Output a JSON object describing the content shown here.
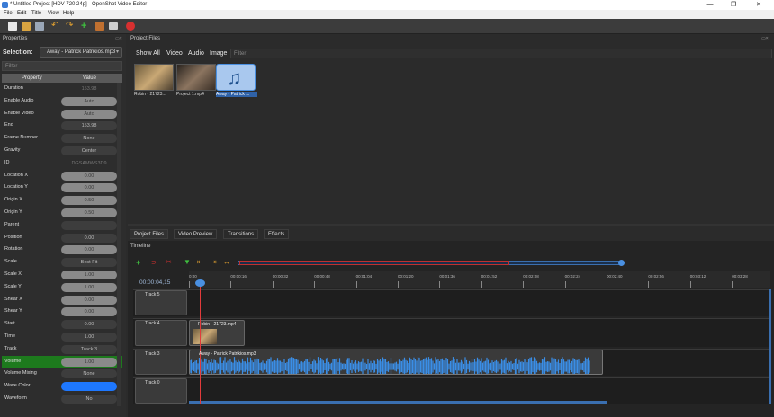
{
  "window": {
    "title": "* Untitled Project [HDV 720 24p] - OpenShot Video Editor",
    "controls": [
      "—",
      "❐",
      "✕"
    ]
  },
  "menubar": [
    "File",
    "Edit",
    "Title",
    "View",
    "Help"
  ],
  "properties": {
    "dock_title": "Properties",
    "selection_label": "Selection:",
    "selection_value": "Away - Patrick Patrikios.mp3",
    "filter_placeholder": "Filter",
    "col_property": "Property",
    "col_value": "Value",
    "rows": [
      {
        "name": "Duration",
        "value": "153.98",
        "style": "dim"
      },
      {
        "name": "Enable Audio",
        "value": "Auto",
        "style": "slider"
      },
      {
        "name": "Enable Video",
        "value": "Auto",
        "style": "slider"
      },
      {
        "name": "End",
        "value": "153.98",
        "style": "plain"
      },
      {
        "name": "Frame Number",
        "value": "None",
        "style": "plain"
      },
      {
        "name": "Gravity",
        "value": "Center",
        "style": "plain"
      },
      {
        "name": "ID",
        "value": "DGSAMWS3D9",
        "style": "dim"
      },
      {
        "name": "Location X",
        "value": "0.00",
        "style": "slider"
      },
      {
        "name": "Location Y",
        "value": "0.00",
        "style": "slider"
      },
      {
        "name": "Origin X",
        "value": "0.50",
        "style": "slider"
      },
      {
        "name": "Origin Y",
        "value": "0.50",
        "style": "slider"
      },
      {
        "name": "Parent",
        "value": "",
        "style": "plain"
      },
      {
        "name": "Position",
        "value": "0.00",
        "style": "plain"
      },
      {
        "name": "Rotation",
        "value": "0.00",
        "style": "slider"
      },
      {
        "name": "Scale",
        "value": "Best Fit",
        "style": "plain"
      },
      {
        "name": "Scale X",
        "value": "1.00",
        "style": "slider"
      },
      {
        "name": "Scale Y",
        "value": "1.00",
        "style": "slider"
      },
      {
        "name": "Shear X",
        "value": "0.00",
        "style": "slider"
      },
      {
        "name": "Shear Y",
        "value": "0.00",
        "style": "slider"
      },
      {
        "name": "Start",
        "value": "0.00",
        "style": "plain"
      },
      {
        "name": "Time",
        "value": "1.00",
        "style": "plain"
      },
      {
        "name": "Track",
        "value": "Track 3",
        "style": "plain"
      },
      {
        "name": "Volume",
        "value": "1.00",
        "style": "volume"
      },
      {
        "name": "Volume Mixing",
        "value": "None",
        "style": "plain"
      },
      {
        "name": "Wave Color",
        "value": "",
        "style": "color"
      },
      {
        "name": "Waveform",
        "value": "No",
        "style": "plain"
      }
    ]
  },
  "project_files": {
    "dock_title": "Project Files",
    "tabs": [
      "Show All",
      "Video",
      "Audio",
      "Image"
    ],
    "filter_placeholder": "Filter",
    "items": [
      {
        "label": "Robin - 21723...",
        "kind": "video"
      },
      {
        "label": "Project 1.mp4",
        "kind": "video"
      },
      {
        "label": "Away - Patrick ...",
        "kind": "audio",
        "selected": true
      }
    ]
  },
  "bottom_tabs": [
    "Project Files",
    "Video Preview",
    "Transitions",
    "Effects"
  ],
  "timeline": {
    "title": "Timeline",
    "timecode": "00:00:04,15",
    "ticks": [
      "0:00",
      "00:00:16",
      "00:00:32",
      "00:00:48",
      "00:01:04",
      "00:01:20",
      "00:01:36",
      "00:01:52",
      "00:02:08",
      "00:02:24",
      "00:02:40",
      "00:02:56",
      "00:03:12",
      "00:03:28"
    ],
    "tracks": [
      {
        "name": "Track 5",
        "clip": ""
      },
      {
        "name": "Track 4",
        "clip": "Robin - 21723.mp4"
      },
      {
        "name": "Track 3",
        "clip": "Away - Patrick Patrikios.mp3"
      },
      {
        "name": "Track 0",
        "clip": ""
      }
    ]
  },
  "colors": {
    "accent": "#4a90e2",
    "wave": "#3a8ee6",
    "playhead": "#e23b3b",
    "volume_row": "#1d7a1d",
    "wave_color_swatch": "#1e78ff"
  }
}
